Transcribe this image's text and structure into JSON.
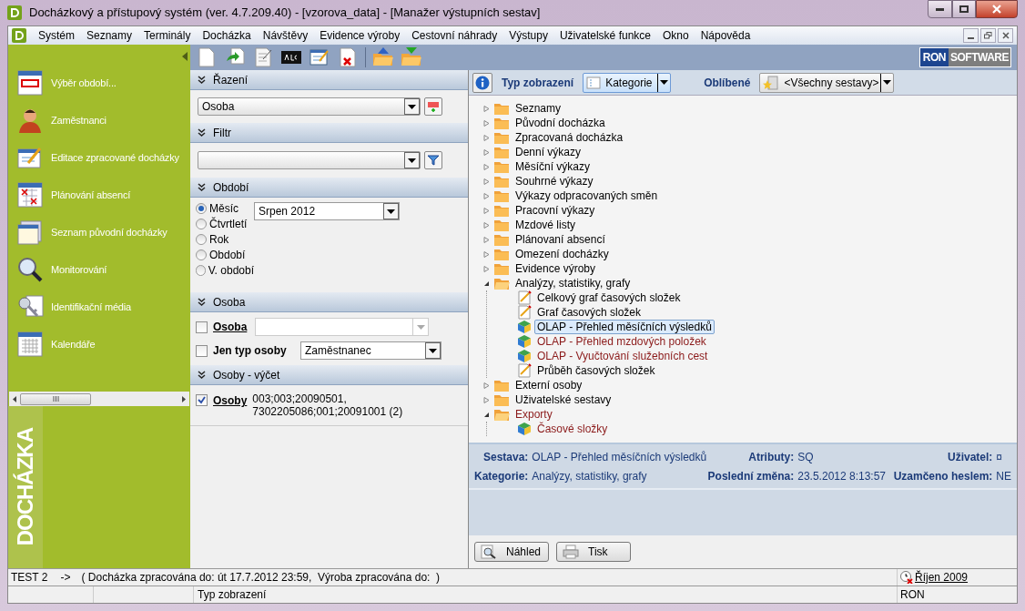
{
  "window": {
    "title": "Docházkový a přístupový systém (ver. 4.7.209.40) - [vzorova_data] - [Manažer výstupních sestav]"
  },
  "menu": [
    "Systém",
    "Seznamy",
    "Terminály",
    "Docházka",
    "Návštěvy",
    "Evidence výroby",
    "Cestovní náhrady",
    "Výstupy",
    "Uživatelské funkce",
    "Okno",
    "Nápověda"
  ],
  "logo": {
    "left": "RON",
    "right": "SOFTWARE"
  },
  "sidebar": {
    "items": [
      "Výběr období...",
      "Zaměstnanci",
      "Editace zpracované docházky",
      "Plánování absencí",
      "Seznam původní docházky",
      "Monitorování",
      "Identifikační média",
      "Kalendáře"
    ],
    "brand": "DOCHÁZKA"
  },
  "sorting": {
    "title": "Řazení",
    "value": "Osoba"
  },
  "filter": {
    "title": "Filtr"
  },
  "period": {
    "title": "Období",
    "options": [
      {
        "label": "Měsíc",
        "selected": true
      },
      {
        "label": "Čtvrtletí",
        "selected": false
      },
      {
        "label": "Rok",
        "selected": false
      },
      {
        "label": "Období",
        "selected": false
      },
      {
        "label": "V. období",
        "selected": false
      }
    ],
    "value": "Srpen 2012"
  },
  "person": {
    "title": "Osoba",
    "rows": [
      {
        "label": "Osoba",
        "checked": false,
        "link": true,
        "value": "",
        "disabled": true
      },
      {
        "label": "Jen typ osoby",
        "checked": false,
        "link": false,
        "value": "Zaměstnanec",
        "disabled": false
      }
    ]
  },
  "persons_list": {
    "title": "Osoby - výčet",
    "label": "Osoby",
    "checked": true,
    "value": "003;003;20090501,\n7302205086;001;20091001 (2)"
  },
  "view": {
    "label": "Typ zobrazení",
    "value": "Kategorie",
    "favorites_label": "Oblíbené",
    "favorites_value": "<Všechny sestavy>"
  },
  "tree": [
    {
      "label": "Seznamy",
      "kind": "folder",
      "expanded": false,
      "selected": false,
      "color": "#000000"
    },
    {
      "label": "Původní docházka",
      "kind": "folder",
      "expanded": false,
      "selected": false,
      "color": "#000000"
    },
    {
      "label": "Zpracovaná docházka",
      "kind": "folder",
      "expanded": false,
      "selected": false,
      "color": "#000000"
    },
    {
      "label": "Denní výkazy",
      "kind": "folder",
      "expanded": false,
      "selected": false,
      "color": "#000000"
    },
    {
      "label": "Měsíční výkazy",
      "kind": "folder",
      "expanded": false,
      "selected": false,
      "color": "#000000"
    },
    {
      "label": "Souhrné výkazy",
      "kind": "folder",
      "expanded": false,
      "selected": false,
      "color": "#000000"
    },
    {
      "label": "Výkazy odpracovaných směn",
      "kind": "folder",
      "expanded": false,
      "selected": false,
      "color": "#000000"
    },
    {
      "label": "Pracovní výkazy",
      "kind": "folder",
      "expanded": false,
      "selected": false,
      "color": "#000000"
    },
    {
      "label": "Mzdové listy",
      "kind": "folder",
      "expanded": false,
      "selected": false,
      "color": "#000000"
    },
    {
      "label": "Plánovaní absencí",
      "kind": "folder",
      "expanded": false,
      "selected": false,
      "color": "#000000"
    },
    {
      "label": "Omezení docházky",
      "kind": "folder",
      "expanded": false,
      "selected": false,
      "color": "#000000"
    },
    {
      "label": "Evidence výroby",
      "kind": "folder",
      "expanded": false,
      "selected": false,
      "color": "#000000"
    },
    {
      "label": "Analýzy, statistiky, grafy",
      "kind": "folder",
      "expanded": true,
      "selected": false,
      "color": "#000000",
      "children": [
        {
          "label": "Celkový graf časových složek",
          "kind": "report",
          "selected": false,
          "color": "#000000"
        },
        {
          "label": "Graf časových složek",
          "kind": "report",
          "selected": false,
          "color": "#000000"
        },
        {
          "label": "OLAP - Přehled měsíčních výsledků",
          "kind": "olap",
          "selected": true,
          "color": "#000000"
        },
        {
          "label": "OLAP - Přehled mzdových položek",
          "kind": "olap",
          "selected": false,
          "color": "#8b1a1a"
        },
        {
          "label": "OLAP - Vyučtování služebních cest",
          "kind": "olap",
          "selected": false,
          "color": "#8b1a1a"
        },
        {
          "label": "Průběh časových složek",
          "kind": "report",
          "selected": false,
          "color": "#000000"
        }
      ]
    },
    {
      "label": "Externí osoby",
      "kind": "folder",
      "expanded": false,
      "selected": false,
      "color": "#000000"
    },
    {
      "label": "Uživatelské sestavy",
      "kind": "folder",
      "expanded": false,
      "selected": false,
      "color": "#000000"
    },
    {
      "label": "Exporty",
      "kind": "folder",
      "expanded": true,
      "selected": false,
      "color": "#8b1a1a",
      "children": [
        {
          "label": "Časové složky",
          "kind": "olap",
          "selected": false,
          "color": "#8b1a1a"
        }
      ]
    }
  ],
  "details": [
    [
      {
        "label": "Sestava:",
        "value": "OLAP - Přehled měsíčních výsledků"
      },
      {
        "label": "Kategorie:",
        "value": "Analýzy, statistiky, grafy"
      }
    ],
    [
      {
        "label": "Atributy:",
        "value": "SQ"
      },
      {
        "label": "Poslední změna:",
        "value": "23.5.2012 8:13:57"
      }
    ],
    [
      {
        "label": "Uživatel:",
        "value": "¤"
      },
      {
        "label": "Uzamčeno heslem:",
        "value": "NE"
      }
    ]
  ],
  "buttons": [
    "Náhled",
    "Tisk"
  ],
  "status_bar": {
    "left": "TEST 2",
    "arrow": "->",
    "text": "( Docházka zpracována do: út 17.7.2012 23:59,  Výroba zpracována do:  )",
    "date": "Říjen 2009"
  },
  "bottom_bar": {
    "middle": "Typ zobrazení",
    "right": "RON"
  }
}
